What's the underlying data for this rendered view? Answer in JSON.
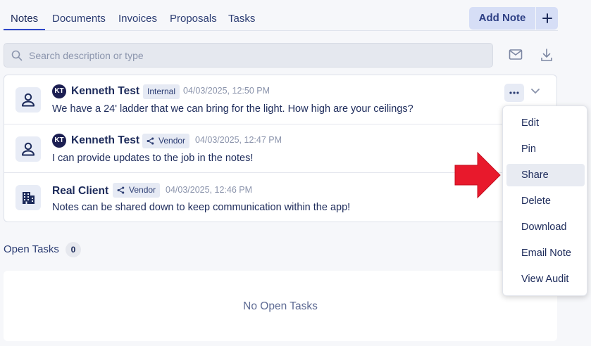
{
  "tabs": [
    {
      "label": "Notes"
    },
    {
      "label": "Documents"
    },
    {
      "label": "Invoices"
    },
    {
      "label": "Proposals"
    },
    {
      "label": "Tasks"
    }
  ],
  "add_note": {
    "label": "Add Note",
    "plus_icon": "plus-icon"
  },
  "search": {
    "placeholder": "Search description or type",
    "value": ""
  },
  "toolbar": {
    "email_icon": "mail-icon",
    "download_icon": "download-icon"
  },
  "notes": [
    {
      "initials": "KT",
      "author": "Kenneth Test",
      "badge": "Internal",
      "timestamp": "04/03/2025, 12:50 PM",
      "message": "We have a 24' ladder that we can bring for the light. How high are your ceilings?",
      "avatar_icon": "person-icon"
    },
    {
      "initials": "KT",
      "author": "Kenneth Test",
      "badge": "Vendor",
      "timestamp": "04/03/2025, 12:47 PM",
      "message": "I can provide updates to the job in the notes!",
      "avatar_icon": "person-icon"
    },
    {
      "initials": "",
      "author": "Real Client",
      "badge": "Vendor",
      "timestamp": "04/03/2025, 12:46 PM",
      "message": "Notes can be shared down to keep communication within the app!",
      "avatar_icon": "building-icon"
    }
  ],
  "menu": {
    "items": [
      {
        "label": "Edit"
      },
      {
        "label": "Pin"
      },
      {
        "label": "Share"
      },
      {
        "label": "Delete"
      },
      {
        "label": "Download"
      },
      {
        "label": "Email Note"
      },
      {
        "label": "View Audit"
      }
    ],
    "hovered": "Share"
  },
  "open_tasks": {
    "label": "Open Tasks",
    "count": "0",
    "empty_text": "No Open Tasks"
  },
  "colors": {
    "accent": "#2f48c9",
    "arrow": "#e8192c",
    "dark_navy": "#1c1f52"
  }
}
